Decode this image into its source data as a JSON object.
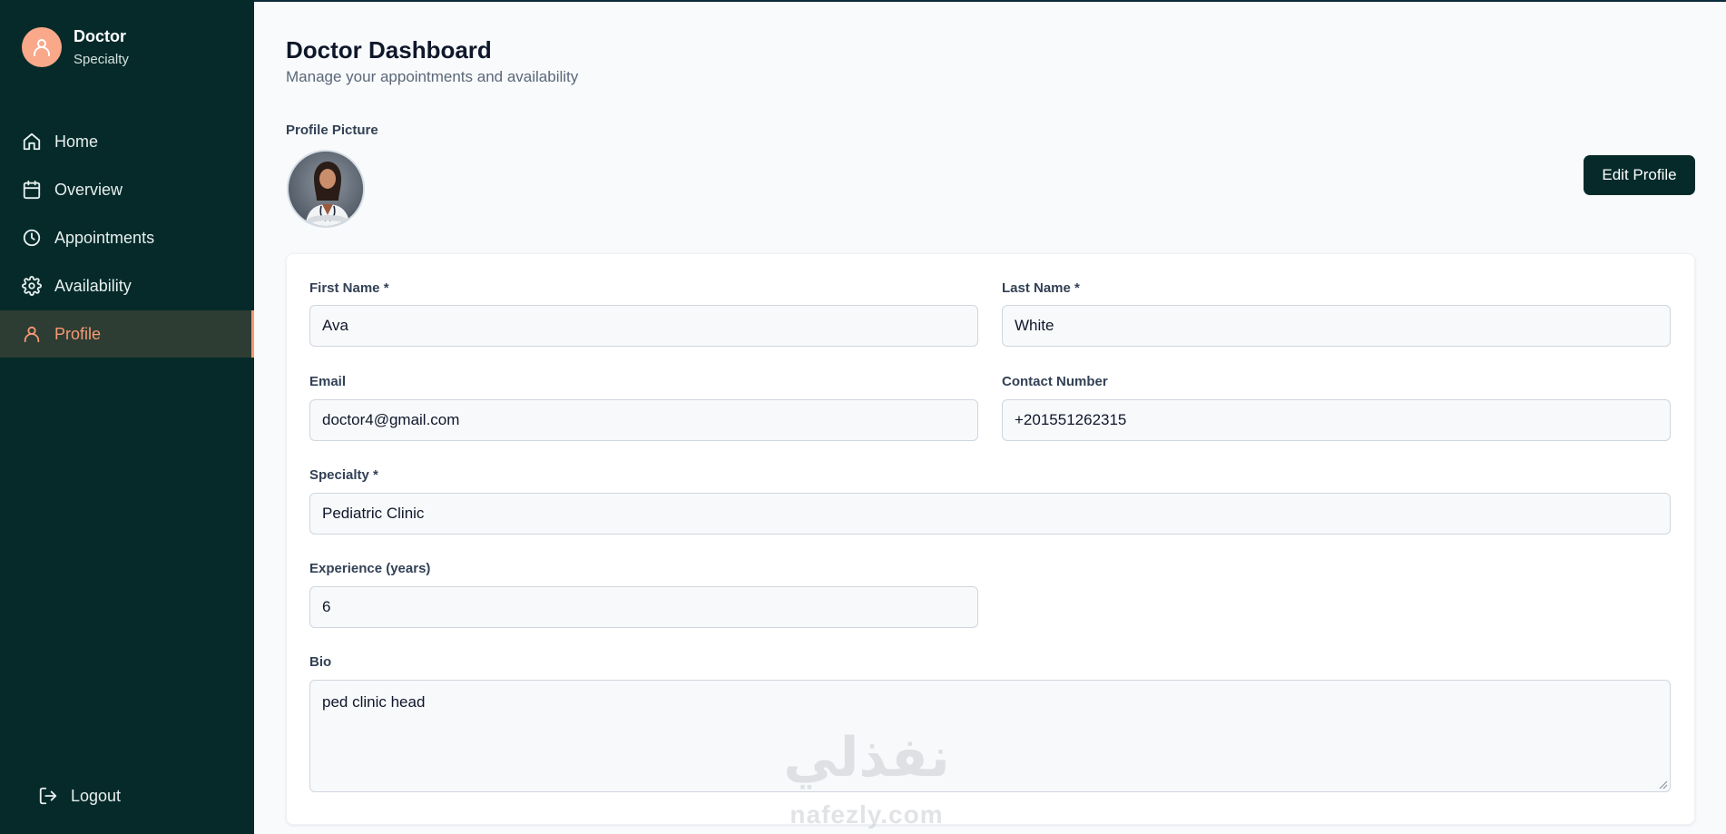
{
  "app": {
    "title": "Doctor Dashboard",
    "subtitle": "Manage your appointments and availability"
  },
  "colors": {
    "sidebar_bg": "#062a2a",
    "accent": "#f59a74",
    "active_bg": "#2d3d33",
    "button_bg": "#062a2a"
  },
  "user": {
    "name": "Doctor",
    "role": "Specialty",
    "icon": "user-icon"
  },
  "sidebar": {
    "items": [
      {
        "label": "Home",
        "icon": "home-icon",
        "active": false
      },
      {
        "label": "Overview",
        "icon": "calendar-icon",
        "active": false
      },
      {
        "label": "Appointments",
        "icon": "clock-icon",
        "active": false
      },
      {
        "label": "Availability",
        "icon": "gear-icon",
        "active": false
      },
      {
        "label": "Profile",
        "icon": "user-icon",
        "active": true
      }
    ],
    "logout_label": "Logout"
  },
  "profile": {
    "picture_label": "Profile Picture",
    "edit_button": "Edit Profile"
  },
  "form": {
    "first_name_label": "First Name *",
    "first_name": "Ava",
    "last_name_label": "Last Name *",
    "last_name": "White",
    "email_label": "Email",
    "email": "doctor4@gmail.com",
    "contact_label": "Contact Number",
    "contact": "+201551262315",
    "specialty_label": "Specialty *",
    "specialty": "Pediatric Clinic",
    "experience_label": "Experience (years)",
    "experience": "6",
    "bio_label": "Bio",
    "bio": "ped clinic head"
  },
  "watermark": {
    "arabic": "نفذلي",
    "latin": "nafezly.com"
  }
}
